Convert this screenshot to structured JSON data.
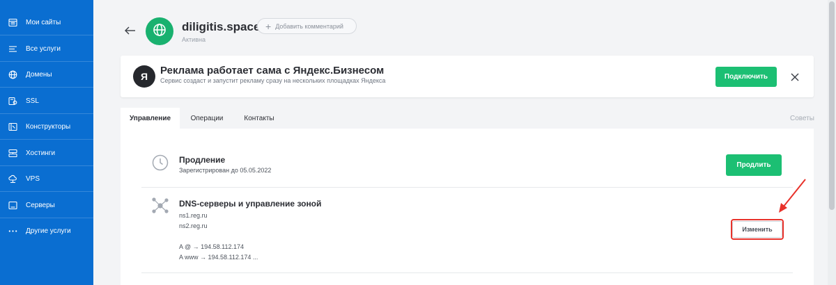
{
  "sidebar": {
    "items": [
      {
        "label": "Мои сайты",
        "icon": "sites-icon"
      },
      {
        "label": "Все услуги",
        "icon": "services-list-icon"
      },
      {
        "label": "Домены",
        "icon": "globe-icon"
      },
      {
        "label": "SSL",
        "icon": "ssl-lock-icon"
      },
      {
        "label": "Конструкторы",
        "icon": "constructor-icon"
      },
      {
        "label": "Хостинги",
        "icon": "hosting-icon"
      },
      {
        "label": "VPS",
        "icon": "vps-cloud-icon"
      },
      {
        "label": "Серверы",
        "icon": "server-icon"
      },
      {
        "label": "Другие услуги",
        "icon": "more-dots-icon"
      }
    ]
  },
  "header": {
    "domain": "diligitis.space",
    "status": "Активна",
    "comment_button": "Добавить комментарий"
  },
  "promo": {
    "logo_letter": "Я",
    "title": "Реклама работает сама с Яндекс.Бизнесом",
    "subtitle": "Сервис создаст и запустит рекламу сразу на нескольких площадках Яндекса",
    "connect_button": "Подключить"
  },
  "tabs": [
    {
      "label": "Управление",
      "active": true
    },
    {
      "label": "Операции",
      "active": false
    },
    {
      "label": "Контакты",
      "active": false
    }
  ],
  "tips_link": "Советы",
  "renewal": {
    "title": "Продление",
    "registered": "Зарегистрирован до 05.05.2022",
    "button": "Продлить"
  },
  "dns": {
    "title": "DNS-серверы и управление зоной",
    "ns1": "ns1.reg.ru",
    "ns2": "ns2.reg.ru",
    "record_a": "A @ → 194.58.112.174",
    "record_www": "A www → 194.58.112.174 ...",
    "button": "Изменить"
  },
  "colors": {
    "sidebar": "#0a6ed1",
    "accent_green": "#1cbf73",
    "annotation_red": "#e8322b"
  }
}
